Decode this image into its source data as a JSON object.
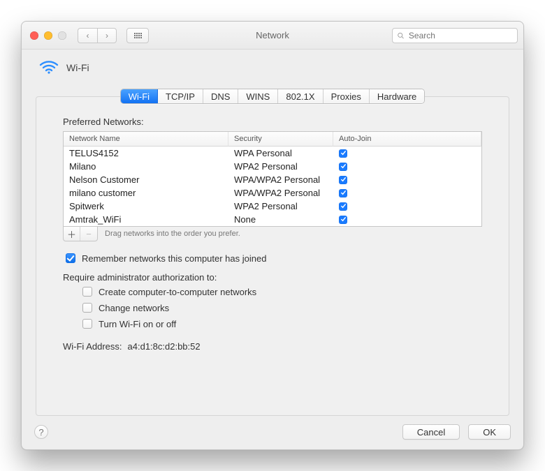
{
  "window": {
    "title": "Network"
  },
  "search": {
    "placeholder": "Search"
  },
  "panel": {
    "title": "Wi-Fi"
  },
  "tabs": [
    "Wi-Fi",
    "TCP/IP",
    "DNS",
    "WINS",
    "802.1X",
    "Proxies",
    "Hardware"
  ],
  "active_tab_index": 0,
  "preferred_label": "Preferred Networks:",
  "columns": {
    "name": "Network Name",
    "security": "Security",
    "auto": "Auto-Join"
  },
  "networks": [
    {
      "name": "TELUS4152",
      "security": "WPA Personal",
      "auto": true
    },
    {
      "name": "Milano",
      "security": "WPA2 Personal",
      "auto": true
    },
    {
      "name": "Nelson Customer",
      "security": "WPA/WPA2 Personal",
      "auto": true
    },
    {
      "name": "milano customer",
      "security": "WPA/WPA2 Personal",
      "auto": true
    },
    {
      "name": "Spitwerk",
      "security": "WPA2 Personal",
      "auto": true
    },
    {
      "name": "Amtrak_WiFi",
      "security": "None",
      "auto": true
    }
  ],
  "drag_hint": "Drag networks into the order you prefer.",
  "remember": {
    "label": "Remember networks this computer has joined",
    "checked": true
  },
  "require_label": "Require administrator authorization to:",
  "req_opts": [
    {
      "label": "Create computer-to-computer networks",
      "checked": false
    },
    {
      "label": "Change networks",
      "checked": false
    },
    {
      "label": "Turn Wi-Fi on or off",
      "checked": false
    }
  ],
  "wifi_addr": {
    "label": "Wi-Fi Address:",
    "value": "a4:d1:8c:d2:bb:52"
  },
  "buttons": {
    "cancel": "Cancel",
    "ok": "OK"
  },
  "icons": {
    "plus": "＋",
    "minus": "−",
    "help": "?"
  }
}
